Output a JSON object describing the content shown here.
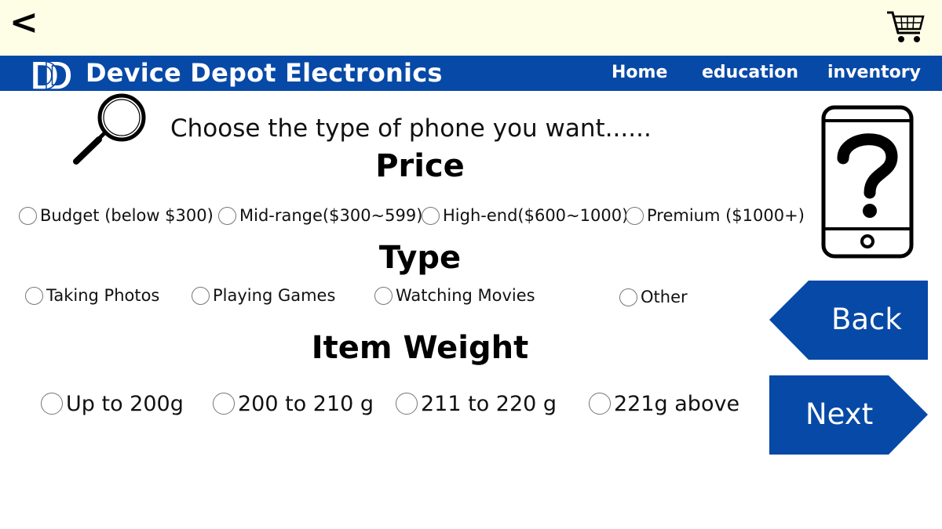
{
  "header": {
    "back_symbol": "<",
    "cart_icon": "shopping-cart-icon"
  },
  "nav": {
    "logo_text": "DD",
    "brand": "Device Depot Electronics",
    "links": [
      "Home",
      "education",
      "inventory"
    ]
  },
  "main": {
    "intro": "Choose the type of phone you want......",
    "sections": [
      {
        "title": "Price",
        "options": [
          "Budget (below $300)",
          "Mid-range($300~599)",
          "High-end($600~1000)",
          "Premium ($1000+)"
        ]
      },
      {
        "title": "Type",
        "options": [
          "Taking Photos",
          "Playing Games",
          "Watching Movies",
          "Other"
        ]
      },
      {
        "title": "Item Weight",
        "options": [
          "Up to 200g",
          "200 to 210 g",
          "211 to 220 g",
          "221g above"
        ]
      }
    ]
  },
  "buttons": {
    "back": "Back",
    "next": "Next"
  },
  "colors": {
    "brand_blue": "#0749a6",
    "top_bar": "#fefee6"
  },
  "icons": [
    "search-icon",
    "phone-question-icon",
    "shopping-cart-icon"
  ]
}
